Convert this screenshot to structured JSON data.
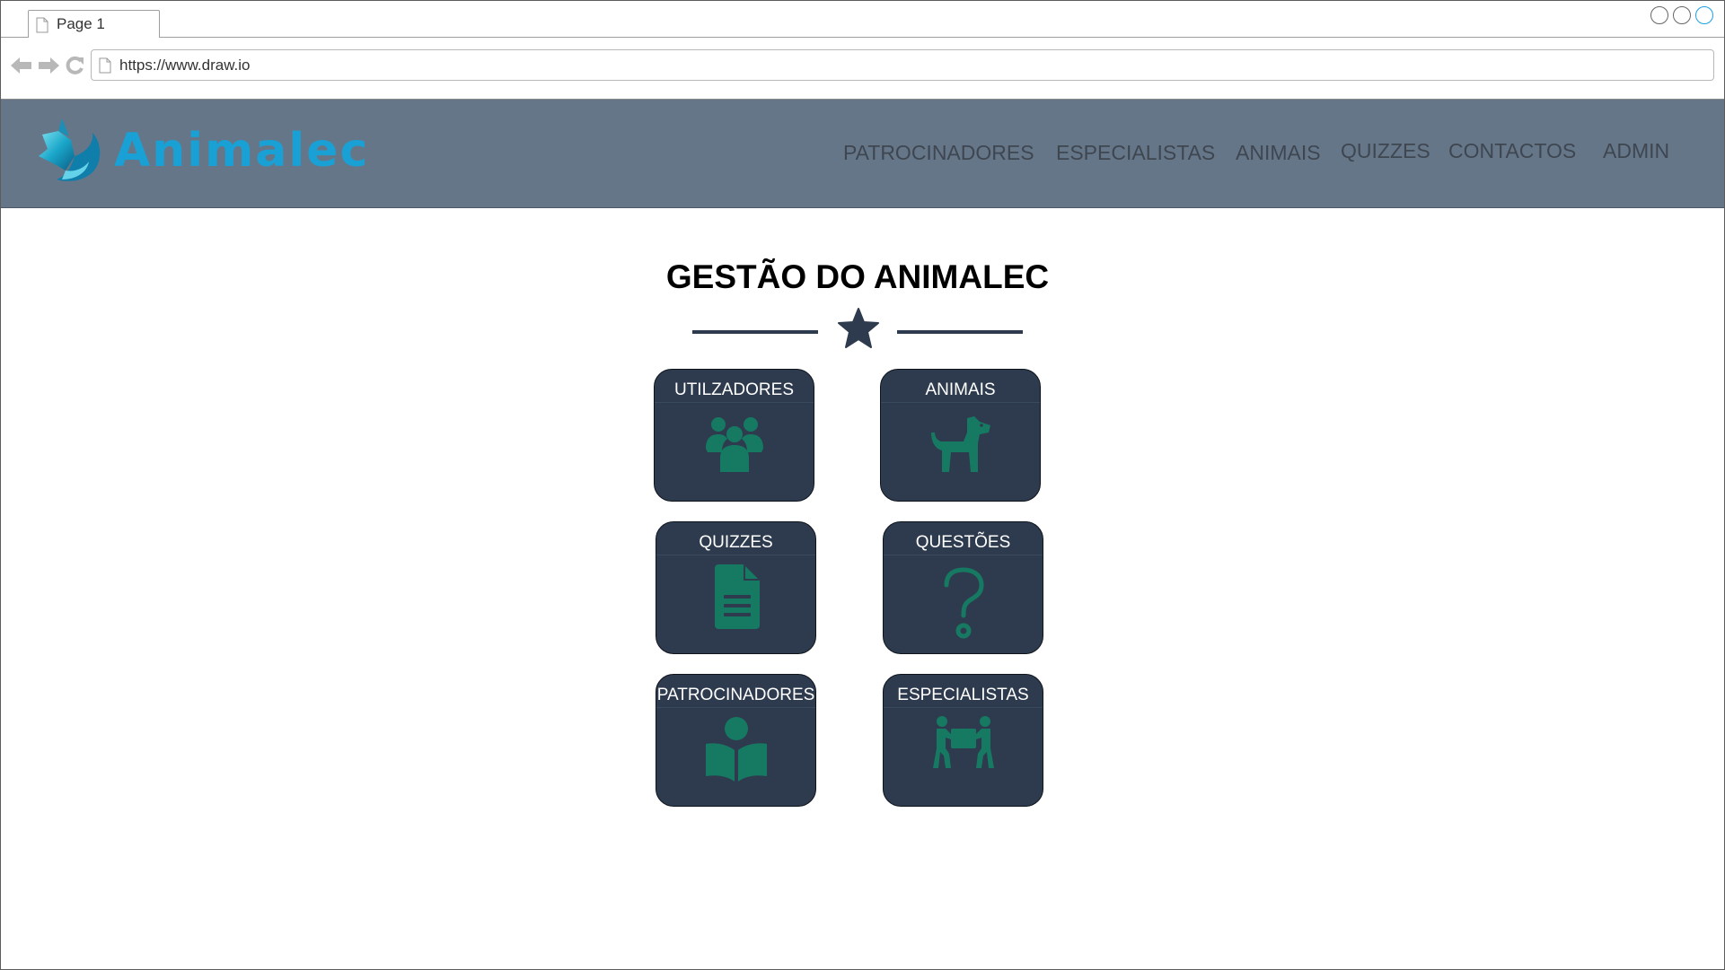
{
  "browser": {
    "tab_label": "Page 1",
    "url": "https://www.draw.io"
  },
  "header": {
    "logo_text": "Animalec",
    "nav": [
      {
        "label": "PATROCINADORES"
      },
      {
        "label": "ESPECIALISTAS"
      },
      {
        "label": "ANIMAIS"
      },
      {
        "label": "QUIZZES"
      },
      {
        "label": "CONTACTOS"
      },
      {
        "label": "ADMIN"
      }
    ]
  },
  "main": {
    "title": "GESTÃO DO ANIMALEC",
    "cards": [
      {
        "label": "UTILZADORES",
        "icon": "users-icon"
      },
      {
        "label": "ANIMAIS",
        "icon": "dog-icon"
      },
      {
        "label": "QUIZZES",
        "icon": "document-icon"
      },
      {
        "label": "QUESTÕES",
        "icon": "question-icon"
      },
      {
        "label": "PATROCINADORES",
        "icon": "reader-icon"
      },
      {
        "label": "ESPECIALISTAS",
        "icon": "carry-box-icon"
      }
    ]
  },
  "colors": {
    "header_bg": "#667689",
    "card_bg": "#2e3b4e",
    "icon_green": "#167a62",
    "logo_blue": "#19a0d4"
  }
}
